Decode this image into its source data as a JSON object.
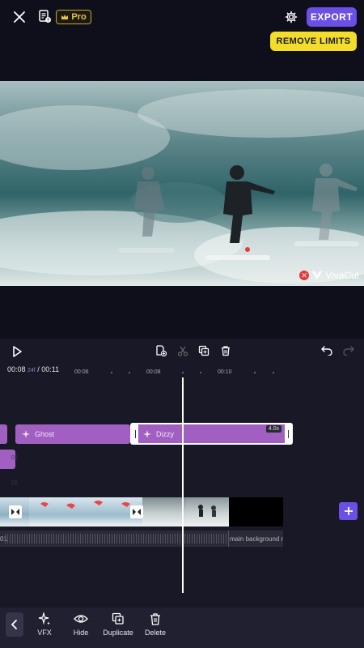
{
  "topbar": {
    "pro_label": "Pro",
    "export_label": "EXPORT",
    "remove_limits_label": "REMOVE LIMITS"
  },
  "preview": {
    "watermark_label": "VivaCut"
  },
  "player": {
    "time_current": "00:08",
    "time_frame": "24f",
    "time_total": "/ 00:11"
  },
  "ruler": {
    "labels": [
      "00:06",
      "00:08",
      "00:10"
    ]
  },
  "tracks": {
    "effect_clips": [
      {
        "label": "Ghost"
      },
      {
        "label": "Dizzy",
        "duration": "4.0s"
      }
    ],
    "row_label_a": "02",
    "row_label_b": "01",
    "audio_index": "01",
    "audio_label": "main background m"
  },
  "bottom": {
    "tools": [
      {
        "label": "VFX",
        "icon": "sparkle-icon"
      },
      {
        "label": "Hide",
        "icon": "eye-icon"
      },
      {
        "label": "Duplicate",
        "icon": "duplicate-icon"
      },
      {
        "label": "Delete",
        "icon": "trash-icon"
      }
    ]
  },
  "colors": {
    "accent": "#6b4fe6",
    "warning": "#f3dc2a",
    "effect_clip": "#a25fc2",
    "background": "#0f0f1c",
    "timeline_bg": "#181826"
  }
}
